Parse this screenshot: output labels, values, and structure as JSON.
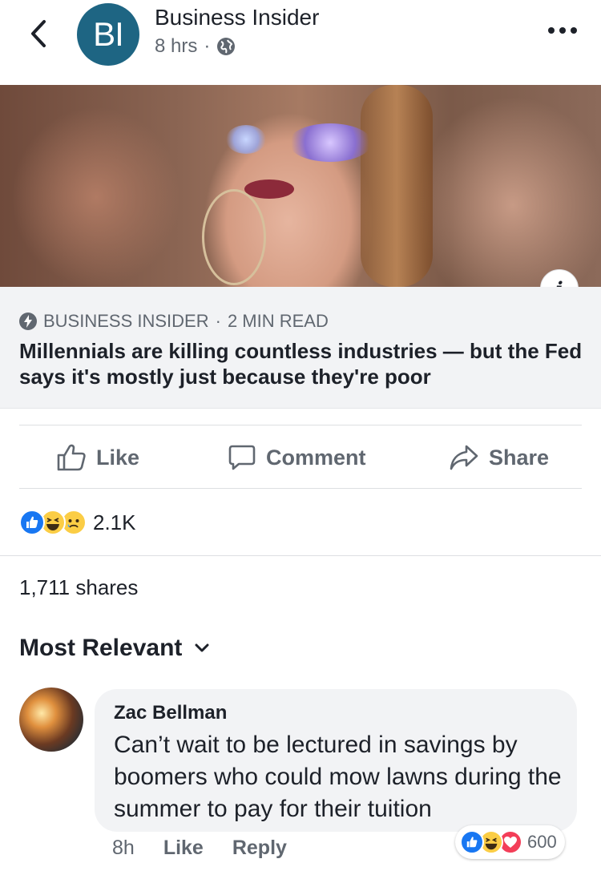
{
  "post": {
    "page_name": "Business Insider",
    "avatar_text": "BI",
    "time": "8 hrs",
    "separator": "·",
    "privacy_icon": "globe-icon"
  },
  "link": {
    "source": "BUSINESS INSIDER",
    "separator": "·",
    "read_time": "2 MIN READ",
    "title": "Millennials are killing countless industries — but the Fed says it's mostly just because they're poor",
    "info_glyph": "i"
  },
  "actions": {
    "like": "Like",
    "comment": "Comment",
    "share": "Share"
  },
  "reactions": {
    "types": [
      "like",
      "haha",
      "sad"
    ],
    "count": "2.1K"
  },
  "shares": "1,711 shares",
  "sort": {
    "label": "Most Relevant"
  },
  "comment": {
    "author": "Zac Bellman",
    "text": "Can’t wait to be lectured in savings by boomers who could mow lawns during the summer to pay for their tuition",
    "time": "8h",
    "like": "Like",
    "reply": "Reply",
    "reaction_types": [
      "like",
      "haha",
      "love"
    ],
    "reaction_count": "600"
  },
  "colors": {
    "bi_blue": "#1e6583",
    "like_blue": "#1877f2",
    "love_red": "#f33e58",
    "emoji_yellow": "#fbcd45",
    "secondary_text": "#606770"
  }
}
